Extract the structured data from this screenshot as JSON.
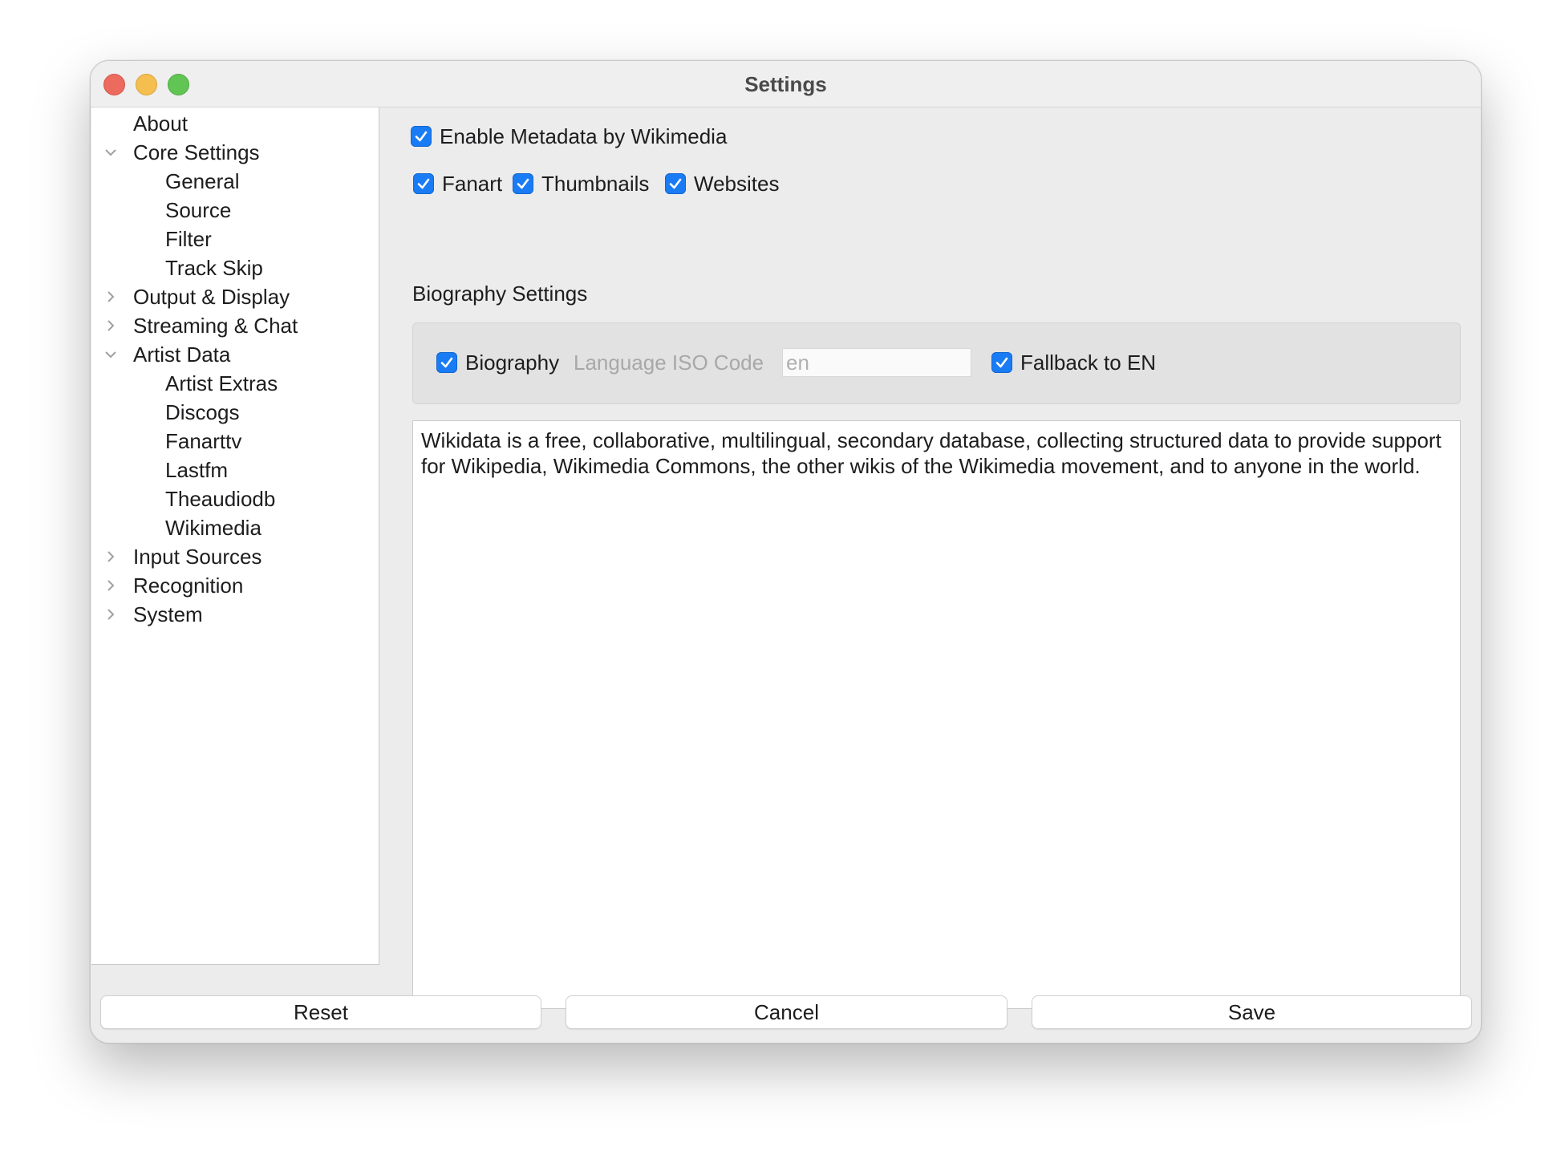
{
  "window": {
    "title": "Settings"
  },
  "sidebar": {
    "items": [
      {
        "label": "About"
      },
      {
        "label": "Core Settings"
      },
      {
        "label": "General"
      },
      {
        "label": "Source"
      },
      {
        "label": "Filter"
      },
      {
        "label": "Track Skip"
      },
      {
        "label": "Output & Display"
      },
      {
        "label": "Streaming & Chat"
      },
      {
        "label": "Artist Data"
      },
      {
        "label": "Artist Extras"
      },
      {
        "label": "Discogs"
      },
      {
        "label": "Fanarttv"
      },
      {
        "label": "Lastfm"
      },
      {
        "label": "Theaudiodb"
      },
      {
        "label": "Wikimedia"
      },
      {
        "label": "Input Sources"
      },
      {
        "label": "Recognition"
      },
      {
        "label": "System"
      }
    ]
  },
  "wikimedia": {
    "enable_label": "Enable Metadata by Wikimedia",
    "fanart_label": "Fanart",
    "thumbnails_label": "Thumbnails",
    "websites_label": "Websites",
    "biography_section_title": "Biography Settings",
    "biography_label": "Biography",
    "language_iso_label": "Language ISO Code",
    "language_iso_value": "en",
    "fallback_label": "Fallback to EN",
    "description": "Wikidata is a free, collaborative, multilingual, secondary database, collecting structured data to provide support for Wikipedia, Wikimedia Commons, the other wikis of the Wikimedia movement, and to anyone in the world."
  },
  "buttons": {
    "reset": "Reset",
    "cancel": "Cancel",
    "save": "Save"
  },
  "colors": {
    "accent": "#1a7cf5",
    "window_bg": "#ececec"
  }
}
